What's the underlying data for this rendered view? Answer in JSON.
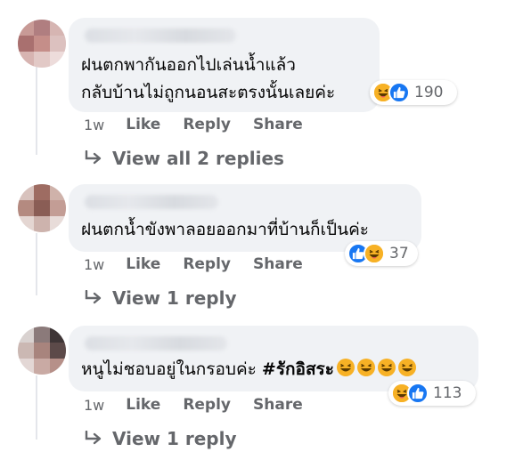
{
  "comments": [
    {
      "text_lines": [
        "ฝนตกพากันออกไปเล่นน้ำแล้ว",
        "กลับบ้านไม่ถูกนอนสะตรงนั้นเลยค่ะ"
      ],
      "reaction_count": "190",
      "reactions": [
        "haha",
        "like"
      ],
      "time": "1w",
      "like_label": "Like",
      "reply_label": "Reply",
      "share_label": "Share",
      "replies_label": "View all 2 replies"
    },
    {
      "text_lines": [
        "ฝนตกน้ำขังพาลอยออกมาที่บ้านก็เป็นค่ะ"
      ],
      "reaction_count": "37",
      "reactions": [
        "like",
        "haha"
      ],
      "time": "1w",
      "like_label": "Like",
      "reply_label": "Reply",
      "share_label": "Share",
      "replies_label": "View 1 reply"
    },
    {
      "text_plain": "หนูไม่ชอบอยู่ในกรอบค่ะ ",
      "hashtag": "#รักอิสระ",
      "trailing_emoji": [
        "laughing",
        "laughing",
        "laughing",
        "laughing"
      ],
      "reaction_count": "113",
      "reactions": [
        "haha",
        "like"
      ],
      "time": "1w",
      "like_label": "Like",
      "reply_label": "Reply",
      "share_label": "Share",
      "replies_label": "View 1 reply"
    }
  ],
  "colors": {
    "bubble": "#f0f2f5",
    "muted_text": "#65676b",
    "like_blue": "#1877f2",
    "haha_yellow": "#f7b125"
  }
}
